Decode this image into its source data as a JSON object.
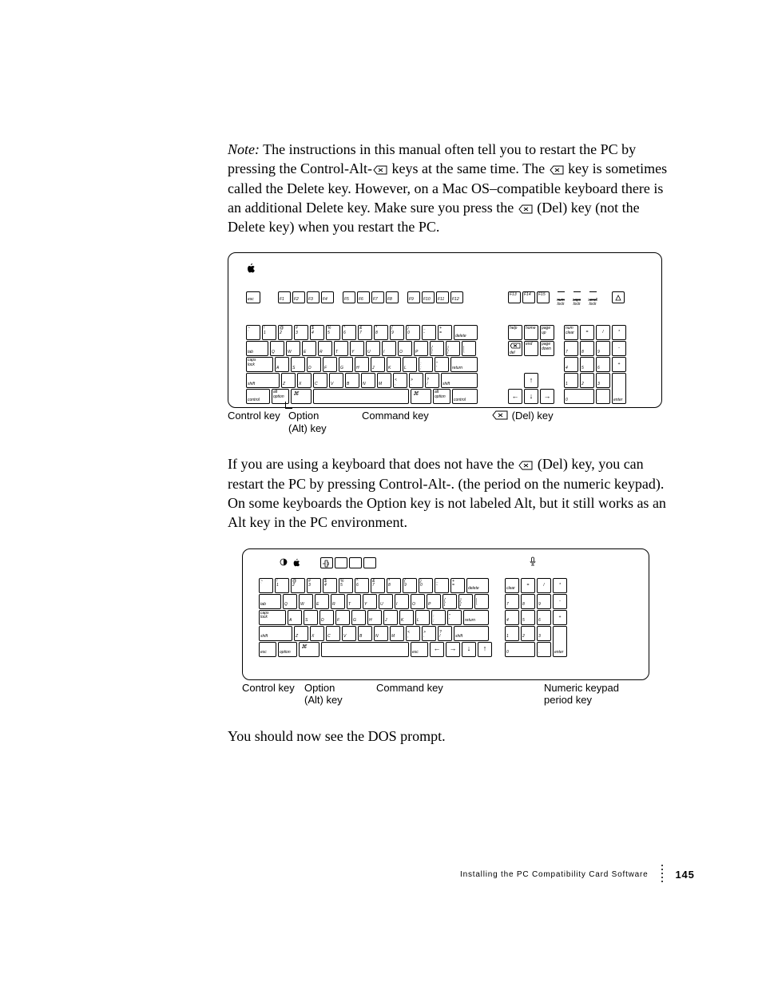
{
  "note_label": "Note:",
  "para1_rest": "  The instructions in this manual often tell you to restart the PC by pressing the Control-Alt-",
  "para1_part2": " keys at the same time. The ",
  "para1_part3": " key is sometimes called the Delete key. However, on a Mac OS–compatible keyboard there is an additional Delete key. Make sure you press the ",
  "para1_part4": " (Del) key (not the Delete key) when you restart the PC.",
  "para2_a": "If you are using a keyboard that does not have the ",
  "para2_b": " (Del) key, you can restart the PC by pressing Control-Alt-. (the period on the numeric keypad). On some keyboards the Option key is not labeled Alt, but it still works as an Alt key in the PC environment.",
  "para3": "You should now see the DOS prompt.",
  "caps": {
    "control": "Control key",
    "option_line1": "Option",
    "option_line2": "(Alt) key",
    "command": "Command key",
    "del": " (Del) key",
    "numpad_line1": "Numeric keypad",
    "numpad_line2": "period key"
  },
  "leds": {
    "num": "num\nlock",
    "caps": "caps\nlock",
    "scroll": "scroll\nlock"
  },
  "footer_title": "Installing the PC Compatibility Card Software",
  "page_number": "145",
  "keys": {
    "esc": "esc",
    "fn": [
      "F1",
      "F2",
      "F3",
      "F4",
      "F5",
      "F6",
      "F7",
      "F8",
      "F9",
      "F10",
      "F11",
      "F12",
      "F13",
      "F14",
      "F15"
    ],
    "tilde": "~\n`",
    "numrow": [
      "!\n1",
      "@\n2",
      "#\n3",
      "$\n4",
      "%\n5",
      "^\n6",
      "&\n7",
      "*\n8",
      "(\n9",
      ")\n0",
      "_\n-",
      "+\n="
    ],
    "delete": "delete",
    "tab": "tab",
    "qrow": [
      "Q",
      "W",
      "E",
      "R",
      "T",
      "Y",
      "U",
      "I",
      "O",
      "P",
      "{\n[",
      "}\n]",
      "|\n\\"
    ],
    "capslock": "caps\nlock",
    "arow": [
      "A",
      "S",
      "D",
      "F",
      "G",
      "H",
      "J",
      "K",
      "L",
      ":\n;",
      "\"\n'"
    ],
    "return": "return",
    "shift": "shift",
    "zrow": [
      "Z",
      "X",
      "C",
      "V",
      "B",
      "N",
      "M",
      "<\n,",
      ">\n.",
      "?\n/"
    ],
    "control": "control",
    "option": "alt\noption",
    "nav": {
      "help": "help",
      "home": "home",
      "pageup": "page\nup",
      "del": "del",
      "end": "end",
      "pagedown": "page\ndown"
    },
    "numpad": {
      "clear": "num\nclear",
      "eq": "=",
      "div": "/",
      "mul": "*",
      "7": "7",
      "8": "8",
      "9": "9",
      "minus": "-",
      "4": "4",
      "5": "5",
      "6": "6",
      "plus": "+",
      "1": "1",
      "2": "2",
      "3": "3",
      "0": "0",
      "dot": ".",
      "enter": "enter"
    },
    "kb2_esc": "esc",
    "kb2_numpad_clear": "clear",
    "kb2_numpad_enter": "enter"
  }
}
